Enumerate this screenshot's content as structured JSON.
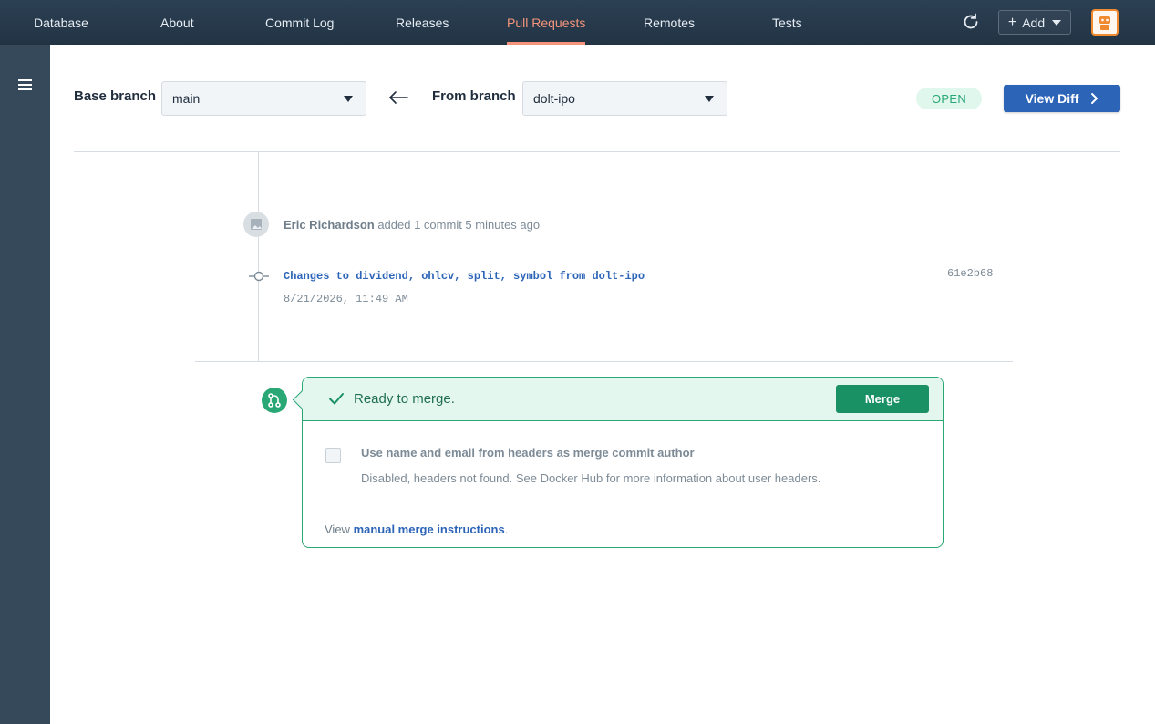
{
  "nav": {
    "tabs": [
      {
        "label": "Database"
      },
      {
        "label": "About"
      },
      {
        "label": "Commit Log"
      },
      {
        "label": "Releases"
      },
      {
        "label": "Pull Requests"
      },
      {
        "label": "Remotes"
      },
      {
        "label": "Tests"
      }
    ],
    "active_tab": "Pull Requests",
    "add_label": "Add",
    "refresh_icon": "refresh-icon",
    "accent_color": "#f4957b"
  },
  "branches": {
    "base_label": "Base branch",
    "base_value": "main",
    "from_label": "From branch",
    "from_value": "dolt-ipo"
  },
  "status": {
    "badge": "OPEN",
    "view_diff_label": "View Diff"
  },
  "activity": {
    "author": "Eric Richardson",
    "action": "added 1 commit 5 minutes ago",
    "commit": {
      "message": "Changes to dividend, ohlcv, split, symbol from dolt-ipo",
      "date": "8/21/2026, 11:49 AM",
      "hash": "61e2b68"
    }
  },
  "merge": {
    "ready_text": "Ready to merge.",
    "merge_button": "Merge",
    "checkbox_label": "Use name and email from headers as merge commit author",
    "checkbox_help": "Disabled, headers not found. See Docker Hub for more information about user headers.",
    "instructions_prefix": "View ",
    "instructions_link": "manual merge instructions",
    "instructions_suffix": "."
  }
}
